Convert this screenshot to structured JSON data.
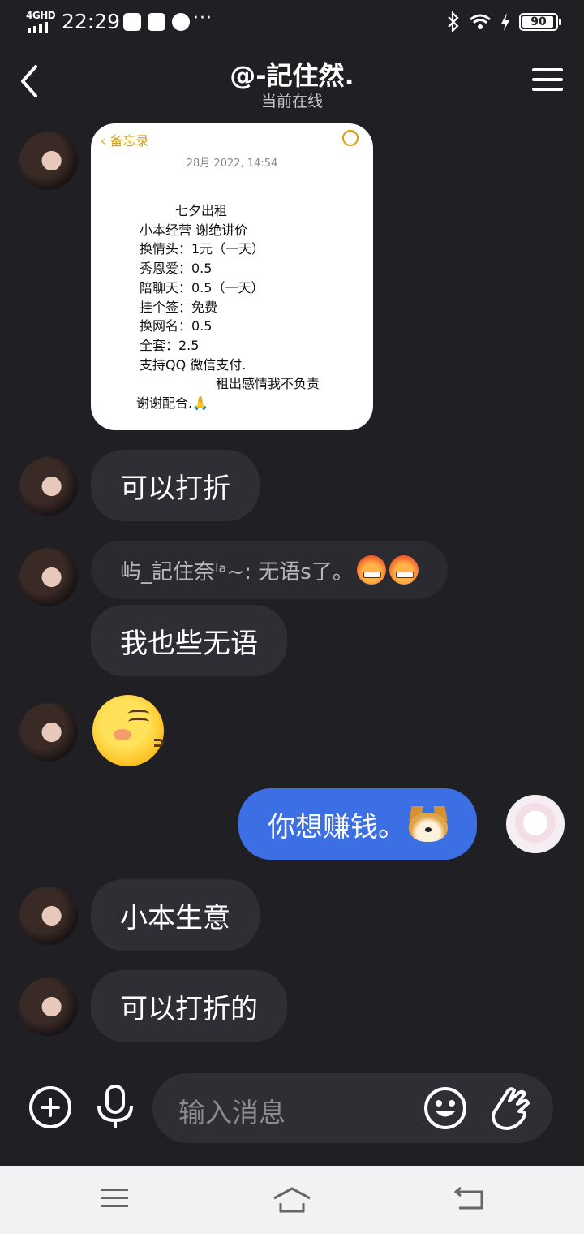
{
  "status_bar": {
    "network": "4GHD",
    "time": "22:29",
    "more": "···",
    "battery": "90"
  },
  "header": {
    "title": "@-記住然.",
    "subtitle": "当前在线"
  },
  "memo": {
    "back_label": "备忘录",
    "date": "28月 2022, 14:54",
    "lines": [
      "七夕出租",
      "小本经营  谢绝讲价",
      "换情头：1元（一天）",
      "秀恩爱：0.5",
      "陪聊天：0.5（一天）",
      "挂个签：免费",
      "换网名：0.5",
      "全套：2.5",
      "支持QQ  微信支付.",
      "租出感情我不负责",
      "谢谢配合.🙏"
    ]
  },
  "messages": {
    "m1": "可以打折",
    "quote": "屿_記住奈ˡᵃ~: 无语s了。",
    "m2": "我也些无语",
    "m3_me": "你想赚钱。",
    "m4": "小本生意",
    "m5": "可以打折的"
  },
  "input": {
    "placeholder": "输入消息"
  },
  "colors": {
    "background": "#1f1f24",
    "bubble_other": "#2e2e34",
    "bubble_me": "#3b6fe3",
    "memo_accent": "#d6a20d"
  },
  "icons": {
    "back": "chevron-left-icon",
    "menu": "hamburger-menu-icon",
    "plus": "plus-circle-icon",
    "mic": "microphone-icon",
    "emoji": "smiley-icon",
    "hand": "poke-hand-icon"
  }
}
